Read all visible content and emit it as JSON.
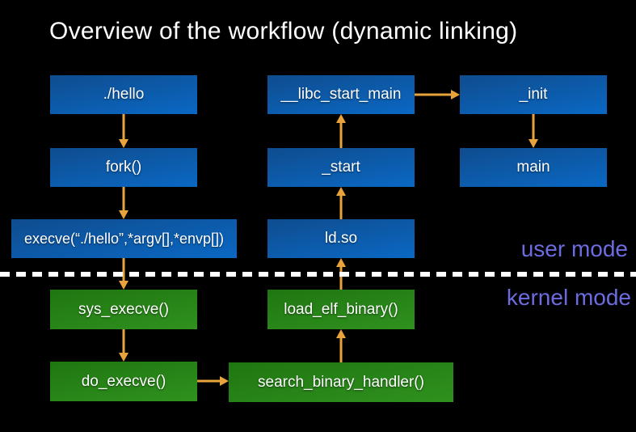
{
  "title": "Overview of the workflow (dynamic linking)",
  "regions": {
    "user_mode_label": "user mode",
    "kernel_mode_label": "kernel mode"
  },
  "colors": {
    "background": "#000000",
    "title_text": "#ffffff",
    "box_text": "#ffffff",
    "blue_top": "#0f4c8e",
    "blue_bottom": "#0a68c4",
    "green_top": "#1f7611",
    "green_bottom": "#2f911e",
    "arrow": "#e8a33c",
    "divider": "#ffffff",
    "mode_label": "#6c6ce0"
  },
  "nodes": [
    {
      "id": "hello",
      "label": "./hello",
      "mode": "user"
    },
    {
      "id": "fork",
      "label": "fork()",
      "mode": "user"
    },
    {
      "id": "execve",
      "label": "execve(“./hello”,*argv[],*envp[])",
      "mode": "user"
    },
    {
      "id": "libc_start_main",
      "label": "__libc_start_main",
      "mode": "user"
    },
    {
      "id": "start",
      "label": "_start",
      "mode": "user"
    },
    {
      "id": "ldso",
      "label": "ld.so",
      "mode": "user"
    },
    {
      "id": "init",
      "label": "_init",
      "mode": "user"
    },
    {
      "id": "main",
      "label": "main",
      "mode": "user"
    },
    {
      "id": "sys_execve",
      "label": "sys_execve()",
      "mode": "kernel"
    },
    {
      "id": "do_execve",
      "label": "do_execve()",
      "mode": "kernel"
    },
    {
      "id": "load_elf_binary",
      "label": "load_elf_binary()",
      "mode": "kernel"
    },
    {
      "id": "search_binary_handler",
      "label": "search_binary_handler()",
      "mode": "kernel"
    }
  ],
  "edges": [
    {
      "from": "hello",
      "to": "fork"
    },
    {
      "from": "fork",
      "to": "execve"
    },
    {
      "from": "execve",
      "to": "sys_execve"
    },
    {
      "from": "sys_execve",
      "to": "do_execve"
    },
    {
      "from": "do_execve",
      "to": "search_binary_handler"
    },
    {
      "from": "search_binary_handler",
      "to": "load_elf_binary"
    },
    {
      "from": "load_elf_binary",
      "to": "ldso"
    },
    {
      "from": "ldso",
      "to": "start"
    },
    {
      "from": "start",
      "to": "libc_start_main"
    },
    {
      "from": "libc_start_main",
      "to": "init"
    },
    {
      "from": "init",
      "to": "main"
    }
  ]
}
